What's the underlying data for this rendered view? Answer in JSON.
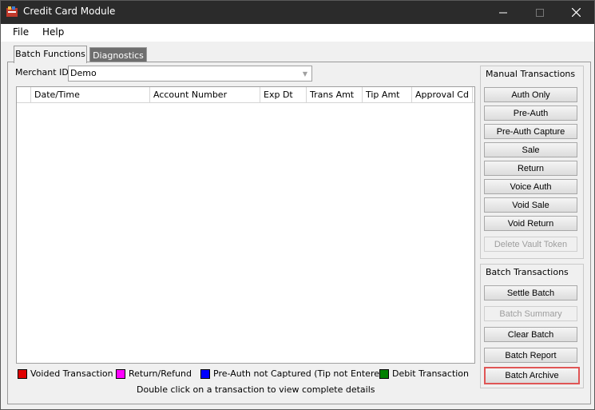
{
  "window": {
    "title": "Credit Card Module"
  },
  "menu": [
    "File",
    "Help"
  ],
  "tabs": [
    {
      "label": "Batch Functions",
      "active": true
    },
    {
      "label": "Diagnostics",
      "active": false
    }
  ],
  "merchant": {
    "label": "Merchant ID",
    "value": "Demo"
  },
  "grid": {
    "columns": [
      "Date/Time",
      "Account Number",
      "Exp Dt",
      "Trans Amt",
      "Tip Amt",
      "Approval Cd"
    ],
    "rows": []
  },
  "manual": {
    "title": "Manual Transactions",
    "buttons": [
      "Auth Only",
      "Pre-Auth",
      "Pre-Auth Capture",
      "Sale",
      "Return",
      "Voice Auth",
      "Void Sale",
      "Void Return",
      "Delete Vault Token"
    ]
  },
  "batch": {
    "title": "Batch Transactions",
    "buttons": [
      "Settle Batch",
      "Batch Summary",
      "Clear Batch",
      "Batch Report",
      "Batch Archive"
    ]
  },
  "legend": [
    {
      "label": "Voided Transaction",
      "color": "#e00000"
    },
    {
      "label": "Return/Refund",
      "color": "#ff00ff"
    },
    {
      "label": "Pre-Auth not Captured (Tip not Entered)",
      "color": "#0000ff"
    },
    {
      "label": "Debit Transaction",
      "color": "#008000"
    }
  ],
  "hint": "Double click on a transaction to view complete details"
}
